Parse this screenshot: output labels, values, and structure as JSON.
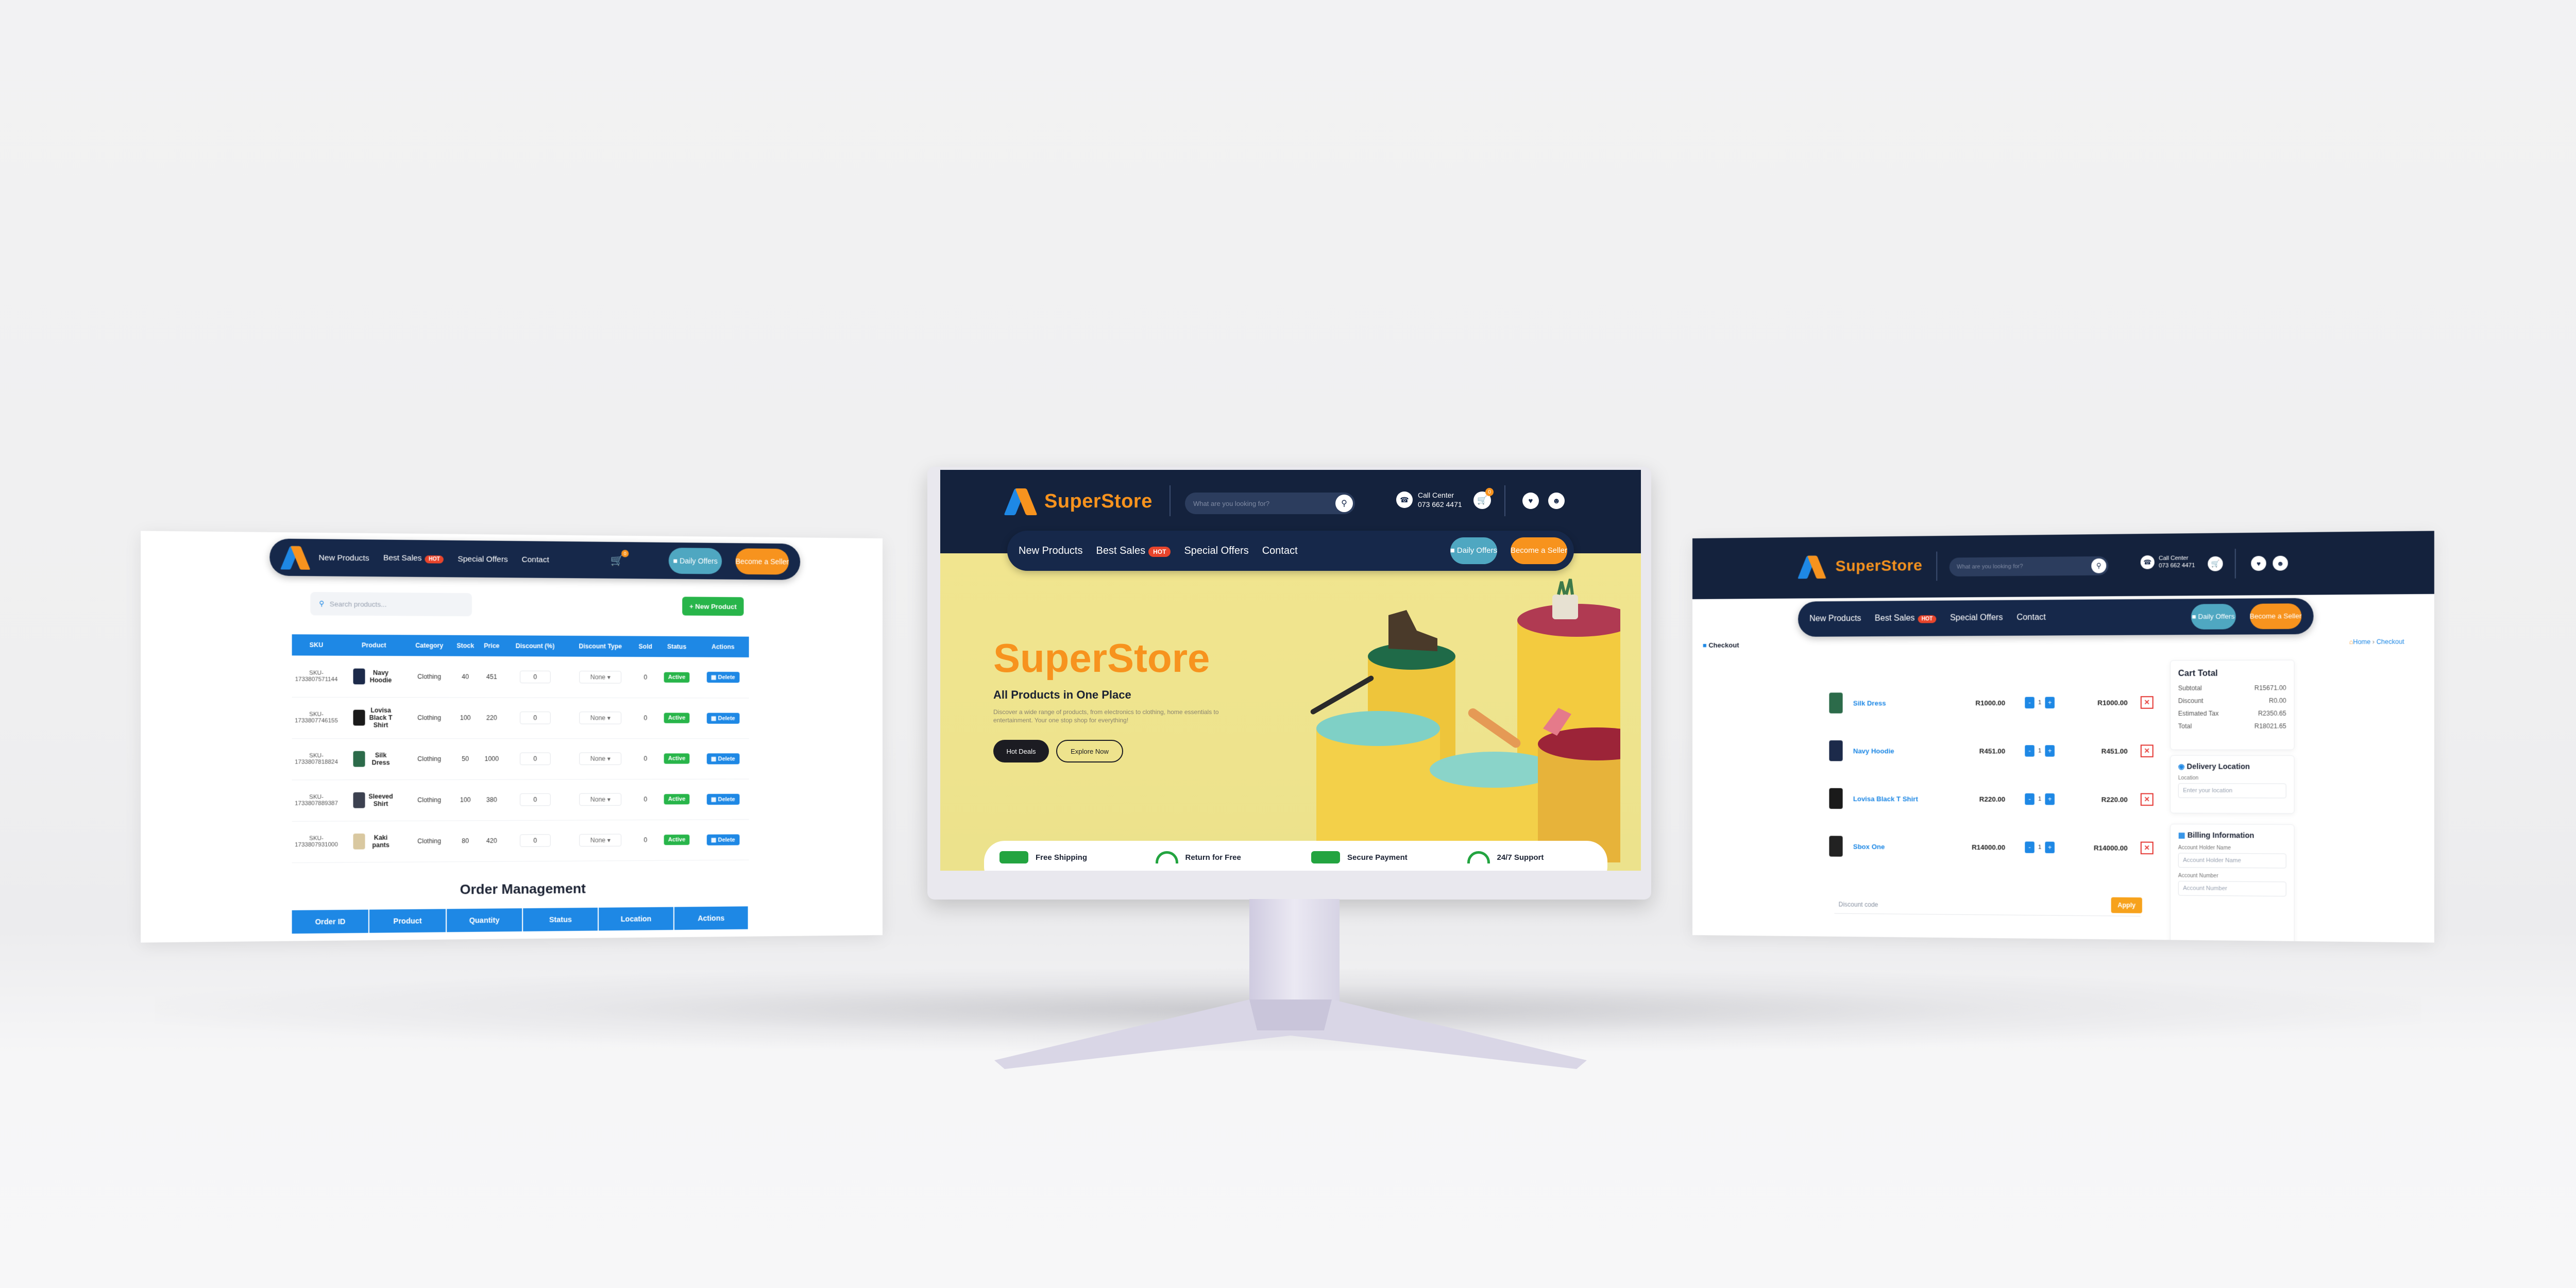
{
  "brand": {
    "name": "SuperStore",
    "orange": "#f7931e",
    "blue": "#1e88e5",
    "navy": "#14223d"
  },
  "nav": {
    "links": [
      "New Products",
      "Best Sales",
      "Special Offers",
      "Contact"
    ],
    "hot_badge": "HOT",
    "daily_offers": "Daily Offers",
    "become_seller": "Become a Seller"
  },
  "header": {
    "search_placeholder": "What are you looking for?",
    "call_center_label": "Call Center",
    "call_center_number": "073 662 4471",
    "cart_count": "0"
  },
  "admin": {
    "search_placeholder": "Search products...",
    "new_product": "+ New Product",
    "columns": [
      "SKU",
      "Product",
      "Category",
      "Stock",
      "Price",
      "Discount (%)",
      "Discount Type",
      "Sold",
      "Status",
      "Actions"
    ],
    "rows": [
      {
        "sku": "SKU-1733807571144",
        "product": "Navy Hoodie",
        "category": "Clothing",
        "stock": "40",
        "price": "451",
        "discount": "0",
        "type": "None",
        "sold": "0",
        "status": "Active",
        "action": "Delete",
        "color": "#1c2a4a"
      },
      {
        "sku": "SKU-1733807746155",
        "product": "Lovisa Black T Shirt",
        "category": "Clothing",
        "stock": "100",
        "price": "220",
        "discount": "0",
        "type": "None",
        "sold": "0",
        "status": "Active",
        "action": "Delete",
        "color": "#1a1a1a"
      },
      {
        "sku": "SKU-1733807818824",
        "product": "Silk Dress",
        "category": "Clothing",
        "stock": "50",
        "price": "1000",
        "discount": "0",
        "type": "None",
        "sold": "0",
        "status": "Active",
        "action": "Delete",
        "color": "#2c6b4a"
      },
      {
        "sku": "SKU-1733807889387",
        "product": "Sleeved Shirt",
        "category": "Clothing",
        "stock": "100",
        "price": "380",
        "discount": "0",
        "type": "None",
        "sold": "0",
        "status": "Active",
        "action": "Delete",
        "color": "#3c4150"
      },
      {
        "sku": "SKU-1733807931000",
        "product": "Kaki pants",
        "category": "Clothing",
        "stock": "80",
        "price": "420",
        "discount": "0",
        "type": "None",
        "sold": "0",
        "status": "Active",
        "action": "Delete",
        "color": "#d9c8a0"
      }
    ],
    "order_title": "Order Management",
    "order_columns": [
      "Order ID",
      "Product",
      "Quantity",
      "Status",
      "Location",
      "Actions"
    ]
  },
  "hero": {
    "title": "SuperStore",
    "subtitle": "All Products in One Place",
    "description": "Discover a wide range of products, from electronics to clothing, home essentials to entertainment. Your one stop shop for everything!",
    "hot_deals": "Hot Deals",
    "explore_now": "Explore Now"
  },
  "features": [
    "Free Shipping",
    "Return for Free",
    "Secure Payment",
    "24/7 Support"
  ],
  "checkout": {
    "crumb": "Checkout",
    "crumb_home": "Home",
    "crumb_current": "Checkout",
    "items": [
      {
        "name": "Silk Dress",
        "price": "R1000.00",
        "qty": "1",
        "subtotal": "R1000.00",
        "color": "#2c6b4a"
      },
      {
        "name": "Navy Hoodie",
        "price": "R451.00",
        "qty": "1",
        "subtotal": "R451.00",
        "color": "#1c2a4a"
      },
      {
        "name": "Lovisa Black T Shirt",
        "price": "R220.00",
        "qty": "1",
        "subtotal": "R220.00",
        "color": "#1a1a1a"
      },
      {
        "name": "Sbox One",
        "price": "R14000.00",
        "qty": "1",
        "subtotal": "R14000.00",
        "color": "#222222"
      }
    ],
    "discount_placeholder": "Discount code",
    "apply": "Apply",
    "cart_total": {
      "title": "Cart Total",
      "rows": [
        {
          "label": "Subtotal",
          "value": "R15671.00"
        },
        {
          "label": "Discount",
          "value": "R0.00"
        },
        {
          "label": "Estimated Tax",
          "value": "R2350.65"
        },
        {
          "label": "Total",
          "value": "R18021.65"
        }
      ]
    },
    "delivery": {
      "title": "Delivery Location",
      "label": "Location",
      "placeholder": "Enter your location"
    },
    "billing": {
      "title": "Billing Information",
      "holder_label": "Account Holder Name",
      "holder_placeholder": "Account Holder Name",
      "number_label": "Account Number",
      "number_placeholder": "Account Number"
    }
  }
}
